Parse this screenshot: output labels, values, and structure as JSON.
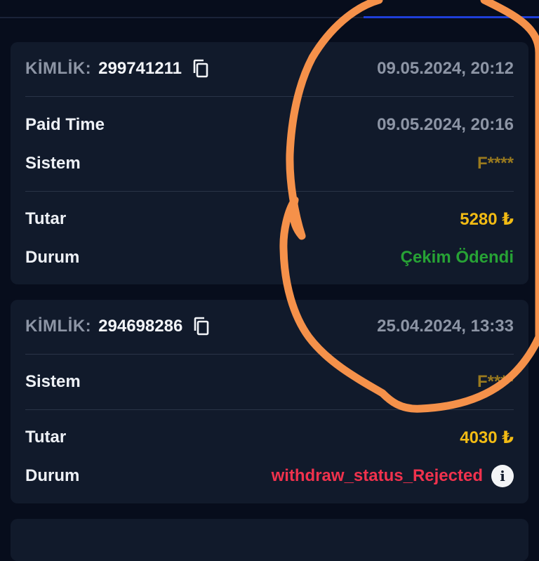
{
  "colors": {
    "background": "#070d1c",
    "card": "#111a2b",
    "amount": "#f2bb14",
    "success": "#27a235",
    "rejected": "#f0324d",
    "annotation": "#f5914a"
  },
  "icons": {
    "copy": "copy-icon",
    "info": "info-icon"
  },
  "transactions": [
    {
      "id_label": "KİMLİK:",
      "id_value": "299741211",
      "created": "09.05.2024, 20:12",
      "paid_time_label": "Paid Time",
      "paid_time_value": "09.05.2024, 20:16",
      "system_label": "Sistem",
      "system_value": "F****",
      "amount_label": "Tutar",
      "amount_value": "5280 ₺",
      "status_label": "Durum",
      "status_value": "Çekim Ödendi"
    },
    {
      "id_label": "KİMLİK:",
      "id_value": "294698286",
      "created": "25.04.2024, 13:33",
      "system_label": "Sistem",
      "system_value": "F****",
      "amount_label": "Tutar",
      "amount_value": "4030 ₺",
      "status_label": "Durum",
      "status_value": "withdraw_status_Rejected",
      "status_info": "i"
    }
  ]
}
